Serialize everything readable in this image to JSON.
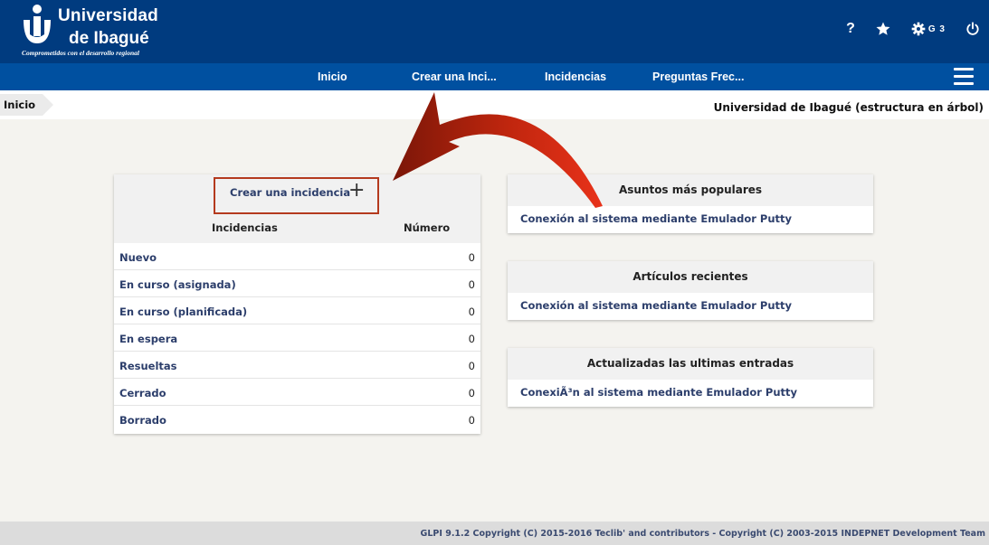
{
  "header": {
    "logo_line1": "Universidad",
    "logo_line2": "de Ibagué",
    "logo_tagline": "Comprometidos con el desarrollo regional",
    "help": "?",
    "profile_label": "G 3"
  },
  "nav": {
    "items": [
      {
        "label": "Inicio"
      },
      {
        "label": "Crear una Inci..."
      },
      {
        "label": "Incidencias"
      },
      {
        "label": "Preguntas Frec..."
      }
    ]
  },
  "breadcrumb": {
    "home": "Inicio",
    "entity": "Universidad de Ibagué (estructura en árbol)"
  },
  "tickets_panel": {
    "create_label": "Crear una incidencia",
    "create_plus": "+",
    "col_name": "Incidencias",
    "col_number": "Número",
    "rows": [
      {
        "label": "Nuevo",
        "value": "0"
      },
      {
        "label": "En curso (asignada)",
        "value": "0"
      },
      {
        "label": "En curso (planificada)",
        "value": "0"
      },
      {
        "label": "En espera",
        "value": "0"
      },
      {
        "label": "Resueltas",
        "value": "0"
      },
      {
        "label": "Cerrado",
        "value": "0"
      },
      {
        "label": "Borrado",
        "value": "0"
      }
    ]
  },
  "popular": {
    "title": "Asuntos más populares",
    "item": "Conexión al sistema mediante Emulador Putty"
  },
  "recent": {
    "title": "Artículos recientes",
    "item": "Conexión al sistema mediante Emulador Putty"
  },
  "updated": {
    "title": "Actualizadas las ultimas entradas",
    "item": "ConexiÃ³n al sistema mediante Emulador Putty"
  },
  "footer": {
    "copyright": "GLPI 9.1.2 Copyright (C) 2015-2016 Teclib' and contributors - Copyright (C) 2003-2015 INDEPNET Development Team"
  },
  "colors": {
    "header_bg": "#003b7f",
    "nav_bg": "#0050a0",
    "link": "#2c3e6b",
    "highlight": "#b43a1e",
    "arrow": "#d42a10"
  },
  "icons": [
    "help-icon",
    "star-icon",
    "gear-icon",
    "power-icon",
    "menu-icon",
    "plus-icon",
    "arrow-annotation"
  ]
}
